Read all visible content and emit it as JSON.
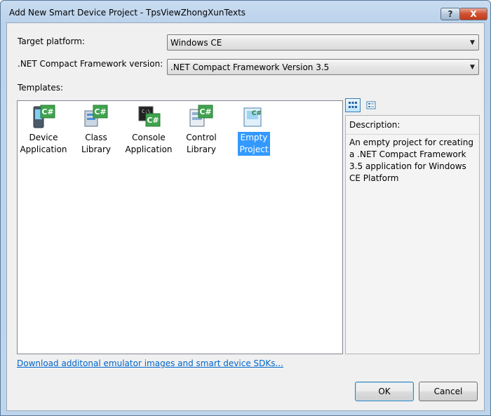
{
  "window": {
    "title": "Add New Smart Device Project - TpsViewZhongXunTexts",
    "help_glyph": "?",
    "close_glyph": "X"
  },
  "form": {
    "target_platform_label": "Target platform:",
    "target_platform_value": "Windows CE",
    "framework_label": ".NET Compact Framework version:",
    "framework_value": ".NET Compact Framework Version 3.5",
    "templates_label": "Templates:"
  },
  "templates": [
    {
      "line1": "Device",
      "line2": "Application",
      "icon": "device-application-icon",
      "selected": false
    },
    {
      "line1": "Class",
      "line2": "Library",
      "icon": "class-library-icon",
      "selected": false
    },
    {
      "line1": "Console",
      "line2": "Application",
      "icon": "console-application-icon",
      "selected": false
    },
    {
      "line1": "Control",
      "line2": "Library",
      "icon": "control-library-icon",
      "selected": false
    },
    {
      "line1": "Empty",
      "line2": "Project",
      "icon": "empty-project-icon",
      "selected": true
    }
  ],
  "view_buttons": [
    "large-icons-view-icon",
    "small-icons-view-icon"
  ],
  "description": {
    "title": "Description:",
    "text": "An empty project for creating a .NET Compact Framework 3.5 application for Windows CE Platform"
  },
  "link": {
    "text": "Download additonal emulator images and smart device SDKs..."
  },
  "buttons": {
    "ok": "OK",
    "cancel": "Cancel"
  },
  "colors": {
    "selection": "#3399ff",
    "link": "#0066cc",
    "close_button": "#c94426"
  }
}
